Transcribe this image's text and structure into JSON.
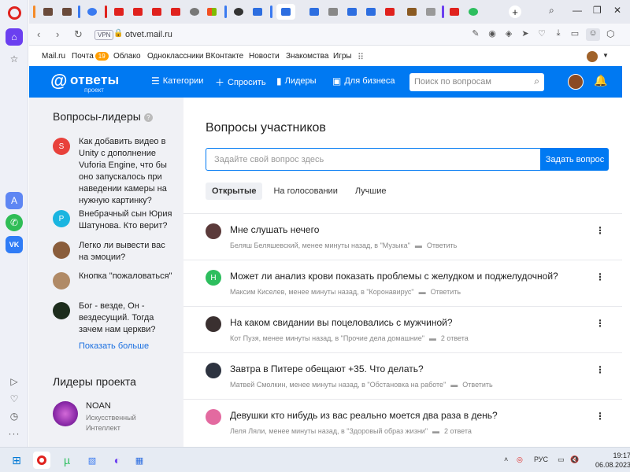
{
  "browser": {
    "url": "otvet.mail.ru",
    "vpn_label": "VPN",
    "colors": {
      "accent": "#0079f2",
      "opera_red": "#e0221e",
      "sidebar_active": "#6b3ff0"
    }
  },
  "mailnav": {
    "items": [
      "Mail.ru",
      "Почта",
      "Облако",
      "Одноклассники",
      "ВКонтакте",
      "Новости",
      "Знакомства",
      "Игры"
    ],
    "mail_badge": "19"
  },
  "header": {
    "brand_name": "ответы",
    "brand_sub": "проект",
    "nav": [
      "Категории",
      "Спросить",
      "Лидеры",
      "Для бизнеса"
    ],
    "search_placeholder": "Поиск по вопросам"
  },
  "left": {
    "leaders_questions_title": "Вопросы-лидеры",
    "questions": [
      {
        "initial": "S",
        "color": "#e8413b",
        "text": "Как добавить видео в Unity с дополнение Vuforia Engine, что бы оно запускалось при наведении камеры на нужную картинку?"
      },
      {
        "initial": "P",
        "color": "#1ab5e0",
        "text": "Внебрачный сын Юрия Шатунова. Кто верит?"
      },
      {
        "initial": "",
        "color": "#8a5d3b",
        "text": "Легко ли вывести вас на эмоции?"
      },
      {
        "initial": "",
        "color": "#b08a66",
        "text": "Кнопка \"пожаловаться\""
      },
      {
        "initial": "",
        "color": "#1d2d1d",
        "text": "Бог - везде, Он - вездесущий. Тогда зачем нам церкви?"
      }
    ],
    "show_more": "Показать больше",
    "project_leaders_title": "Лидеры проекта",
    "leader": {
      "name": "NOAN",
      "desc": "Искусственный Интеллект"
    }
  },
  "main": {
    "title": "Вопросы участников",
    "ask_placeholder": "Задайте свой вопрос здесь",
    "ask_button": "Задать вопрос",
    "tabs": [
      "Открытые",
      "На голосовании",
      "Лучшие"
    ],
    "questions": [
      {
        "initial": "",
        "color": "#5b3a3a",
        "title": "Мне слушать нечего",
        "meta": "Беляш Беляшевский, менее минуты назад, в \"Музыка\"",
        "action": "Ответить"
      },
      {
        "initial": "Н",
        "color": "#2dbe5e",
        "title": "Может ли анализ крови показать проблемы с желудком и поджелудочной?",
        "meta": "Максим Киселев, менее минуты назад, в \"Коронавирус\"",
        "action": "Ответить"
      },
      {
        "initial": "",
        "color": "#3a3030",
        "title": "На каком свидании вы поцеловались с мужчиной?",
        "meta": "Кот Пузя, менее минуты назад, в \"Прочие дела домашние\"",
        "action": "2 ответа"
      },
      {
        "initial": "",
        "color": "#2d3340",
        "title": "Завтра в Питере обещают +35. Что делать?",
        "meta": "Матвей Смолкин, менее минуты назад, в \"Обстановка на работе\"",
        "action": "Ответить"
      },
      {
        "initial": "",
        "color": "#e36aa0",
        "title": "Девушки кто нибудь из вас реально моется два раза в день?",
        "meta": "Леля Ляли, менее минуты назад, в \"Здоровый образ жизни\"",
        "action": "2 ответа"
      }
    ]
  },
  "taskbar": {
    "lang": "РУС",
    "time": "19:17",
    "date": "06.08.2023"
  }
}
